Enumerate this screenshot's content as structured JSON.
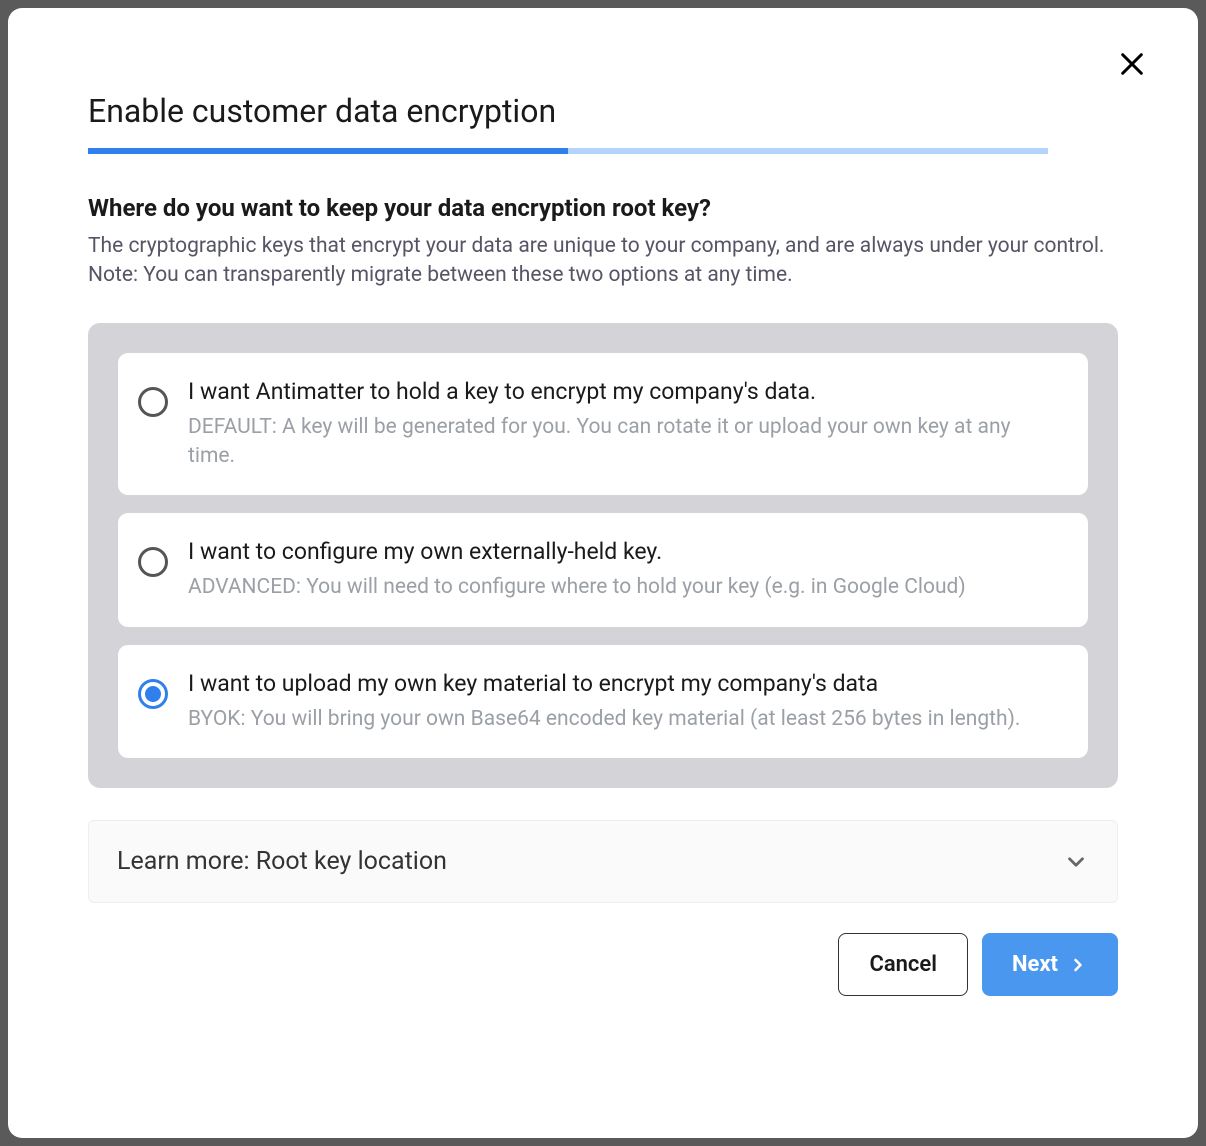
{
  "dialog": {
    "title": "Enable customer data encryption",
    "question": "Where do you want to keep your data encryption root key?",
    "subtext": "The cryptographic keys that encrypt your data are unique to your company, and are always under your control. Note: You can transparently migrate between these two options at any time.",
    "options": [
      {
        "title": "I want Antimatter to hold a key to encrypt my company's data.",
        "description": "DEFAULT: A key will be generated for you. You can rotate it or upload your own key at any time.",
        "selected": false
      },
      {
        "title": "I want to configure my own externally-held key.",
        "description": "ADVANCED: You will need to configure where to hold your key (e.g. in Google Cloud)",
        "selected": false
      },
      {
        "title": "I want to upload my own key material to encrypt my company's data",
        "description": "BYOK: You will bring your own Base64 encoded key material (at least 256 bytes in length).",
        "selected": true
      }
    ],
    "learn_more": "Learn more: Root key location",
    "buttons": {
      "cancel": "Cancel",
      "next": "Next"
    }
  }
}
